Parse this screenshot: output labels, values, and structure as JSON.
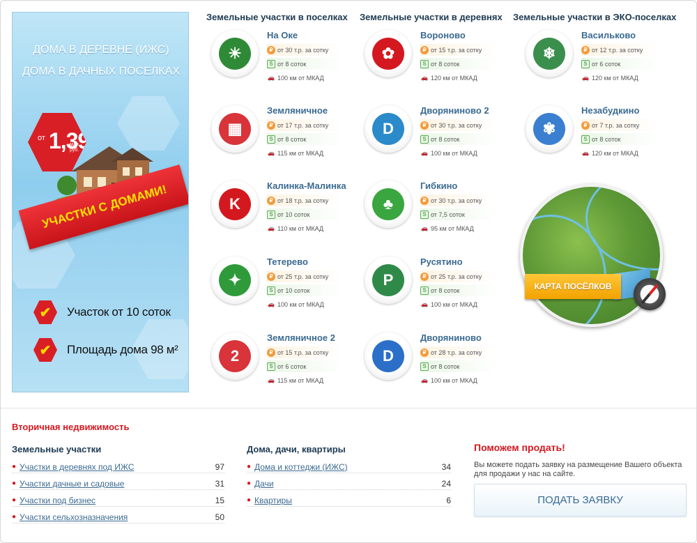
{
  "banner": {
    "title_line1": "ДОМА В ДЕРЕВНЕ (ИЖС)",
    "title_line2": "ДОМА В ДАЧНЫХ ПОСЕЛКАХ",
    "price_from": "от",
    "price_value": "1,39",
    "price_unit": "млн. руб.",
    "ribbon": "УЧАСТКИ С ДОМАМИ!",
    "features": [
      {
        "text": "Участок от 10 соток"
      },
      {
        "text": "Площадь дома 98 м²"
      }
    ]
  },
  "columns": [
    {
      "title": "Земельные участки в поселках"
    },
    {
      "title": "Земельные участки в деревнях"
    },
    {
      "title": "Земельные участки в ЭКО-поселках"
    }
  ],
  "settlements": [
    {
      "name": "На Оке",
      "price": "от 30 т.р. за сотку",
      "area": "от 8 соток",
      "distance": "100 км от МКАД",
      "logo": "sun-field-icon",
      "color": "#2f8a37"
    },
    {
      "name": "Земляничное",
      "price": "от 17 т.р. за сотку",
      "area": "от 8 соток",
      "distance": "115 км от МКАД",
      "logo": "strawberry-icon",
      "color": "#d8343a"
    },
    {
      "name": "Калинка-Малинка",
      "price": "от 18 т.р. за сотку",
      "area": "от 10 соток",
      "distance": "110 км от МКАД",
      "logo": "letter-k-icon",
      "color": "#d4181f"
    },
    {
      "name": "Тетерево",
      "price": "от 25 т.р. за сотку",
      "area": "от 10 соток",
      "distance": "100 км от МКАД",
      "logo": "grouse-icon",
      "color": "#2f9a3a"
    },
    {
      "name": "Земляничное 2",
      "price": "от 15 т.р. за сотку",
      "area": "от 6 соток",
      "distance": "115 км от МКАД",
      "logo": "strawberry-2-icon",
      "color": "#d8343a"
    },
    {
      "name": "Вороново",
      "price": "от 15 т.р. за сотку",
      "area": "от 8 соток",
      "distance": "120 км от МКАД",
      "logo": "apple-tree-icon",
      "color": "#d4181f"
    },
    {
      "name": "Дворяниново 2",
      "price": "от 30 т.р. за сотку",
      "area": "от 8 соток",
      "distance": "100 км от МКАД",
      "logo": "letter-d-2-icon",
      "color": "#2b8ac9"
    },
    {
      "name": "Гибкино",
      "price": "от 30 т.р. за сотку",
      "area": "от 7,5 соток",
      "distance": "95 км от МКАД",
      "logo": "tree-icon",
      "color": "#3aa63f"
    },
    {
      "name": "Русятино",
      "price": "от 25 т.р. за сотку",
      "area": "от 8 соток",
      "distance": "100 км от МКАД",
      "logo": "letter-p-icon",
      "color": "#2f8a4a"
    },
    {
      "name": "Дворяниново",
      "price": "от 28 т.р. за сотку",
      "area": "от 8 соток",
      "distance": "100 км от МКАД",
      "logo": "letter-d-icon",
      "color": "#2b6fc9"
    },
    {
      "name": "Васильково",
      "price": "от 12 т.р. за сотку",
      "area": "от 6 соток",
      "distance": "120 км от МКАД",
      "logo": "cornflower-icon",
      "color": "#3a8f4c"
    },
    {
      "name": "Незабудкино",
      "price": "от 7 т.р. за сотку",
      "area": "от 8 соток",
      "distance": "120 км от МКАД",
      "logo": "forget-me-not-icon",
      "color": "#3b7fd0"
    }
  ],
  "map": {
    "label": "КАРТА ПОСЁЛКОВ"
  },
  "secondary": {
    "title": "Вторичная недвижимость",
    "land": {
      "title": "Земельные участки",
      "items": [
        {
          "label": "Участки в деревнях под ИЖС",
          "count": "97"
        },
        {
          "label": "Участки дачные и садовые",
          "count": "31"
        },
        {
          "label": "Участки под бизнес",
          "count": "15"
        },
        {
          "label": "Участки сельхозназначения",
          "count": "50"
        }
      ]
    },
    "houses": {
      "title": "Дома, дачи, квартиры",
      "items": [
        {
          "label": "Дома и коттеджи (ИЖС)",
          "count": "34"
        },
        {
          "label": "Дачи",
          "count": "24"
        },
        {
          "label": "Квартиры",
          "count": "6"
        }
      ]
    }
  },
  "help": {
    "title": "Поможем продать!",
    "text": "Вы можете подать заявку на размещение Вашего объекта для продажи у нас на сайте.",
    "button": "ПОДАТЬ ЗАЯВКУ"
  }
}
